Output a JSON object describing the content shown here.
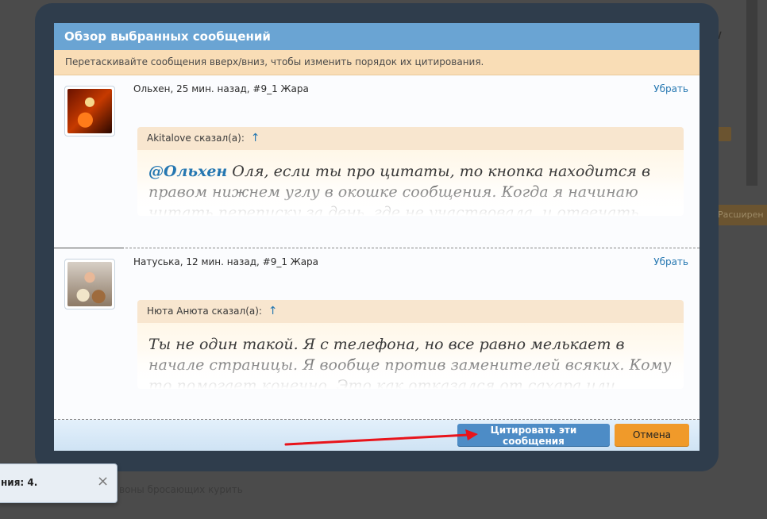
{
  "background": {
    "extend_label": "Расширен",
    "bottom_text": "воны бросающих курить"
  },
  "dialog": {
    "title": "Обзор выбранных сообщений",
    "instruction": "Перетаскивайте сообщения вверх/вниз, чтобы изменить порядок их цитирования.",
    "messages": [
      {
        "meta": "Ольхен, 25 мин. назад, #9_1 Жара",
        "remove_label": "Убрать",
        "quote_author": "Akitalove сказал(а):",
        "quote_arrow": "↑",
        "mention": "@Ольхен",
        "quote_text": " Оля, если ты про цитаты, то кнопка находится в правом нижнем углу в окошке сообщения. Когда я начинаю читать переписку за день, где не участвовала, и отвечать всем по порядку"
      },
      {
        "meta": "Натуська, 12 мин. назад, #9_1 Жара",
        "remove_label": "Убрать",
        "quote_author": "Нюта Анюта сказал(а):",
        "quote_arrow": "↑",
        "quote_text": "Ты не один такой. Я с телефона, но все равно мелькает в начале страницы. Я вообще против заменителей всяких. Кому то помогает конечно. Это как отказался от сахара или майонеза и т.д."
      }
    ],
    "buttons": {
      "quote_label": "Цитировать эти сообщения",
      "cancel_label": "Отмена"
    }
  },
  "toast": {
    "text": "ния: 4.",
    "close_icon": "×"
  },
  "colors": {
    "header": "#6aa4d3",
    "instruction_bg": "#f9ddb6",
    "link": "#2577b1",
    "primary_button": "#4d8cc6",
    "cancel_button": "#f09a2a",
    "annotation_arrow": "#e8141b"
  }
}
